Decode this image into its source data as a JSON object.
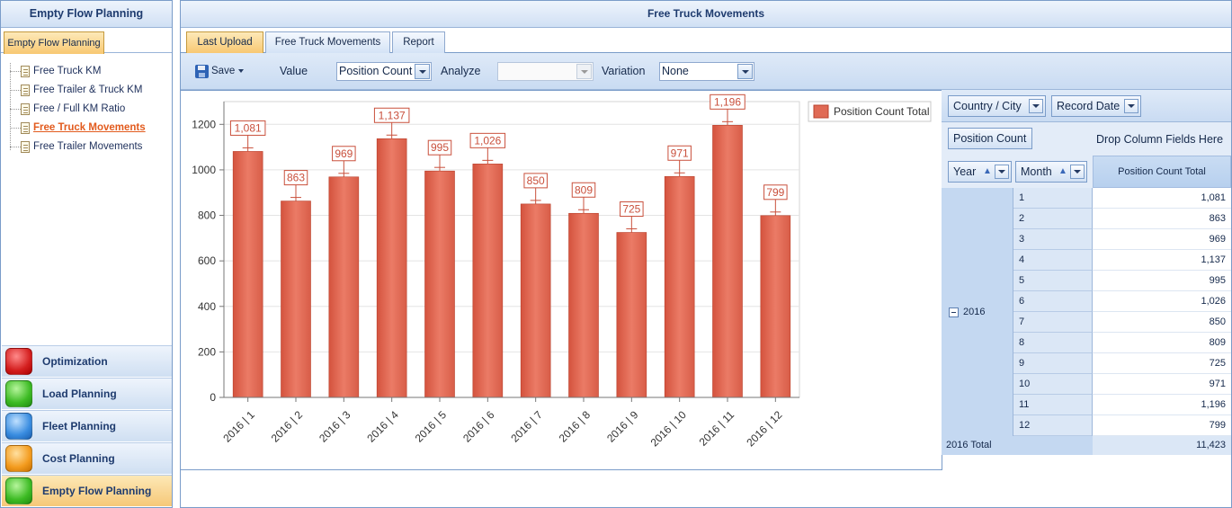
{
  "left_panel": {
    "title": "Empty Flow Planning",
    "tab_label": "Empty Flow Planning",
    "tree_items": [
      {
        "label": "Free Truck KM"
      },
      {
        "label": "Free Trailer & Truck KM"
      },
      {
        "label": "Free / Full KM Ratio"
      },
      {
        "label": "Free Truck Movements"
      },
      {
        "label": "Free Trailer Movements"
      }
    ],
    "active_tree_item": "Free Truck Movements",
    "nav_buttons": [
      {
        "label": "Optimization",
        "icon": "red-square-icon"
      },
      {
        "label": "Load Planning",
        "icon": "green-square-icon"
      },
      {
        "label": "Fleet Planning",
        "icon": "blue-square-icon"
      },
      {
        "label": "Cost Planning",
        "icon": "orange-square-icon"
      },
      {
        "label": "Empty Flow Planning",
        "icon": "green-square-icon"
      }
    ],
    "active_nav": "Empty Flow Planning"
  },
  "main": {
    "title": "Free Truck Movements",
    "tabs": [
      {
        "label": "Last Upload"
      },
      {
        "label": "Free Truck Movements"
      },
      {
        "label": "Report"
      }
    ],
    "active_tab": "Last Upload",
    "toolbar": {
      "save_label": "Save",
      "value_label": "Value",
      "value_selected": "Position Count",
      "analyze_label": "Analyze",
      "analyze_selected": "",
      "variation_label": "Variation",
      "variation_selected": "None"
    }
  },
  "chart_data": {
    "type": "bar",
    "categories": [
      "2016 | 1",
      "2016 | 2",
      "2016 | 3",
      "2016 | 4",
      "2016 | 5",
      "2016 | 6",
      "2016 | 7",
      "2016 | 8",
      "2016 | 9",
      "2016 | 10",
      "2016 | 11",
      "2016 | 12"
    ],
    "series": [
      {
        "name": "Position Count Total",
        "values": [
          1081,
          863,
          969,
          1137,
          995,
          1026,
          850,
          809,
          725,
          971,
          1196,
          799
        ]
      }
    ],
    "data_labels": [
      "1,081",
      "863",
      "969",
      "1,137",
      "995",
      "1,026",
      "850",
      "809",
      "725",
      "971",
      "1,196",
      "799"
    ],
    "yticks": [
      0,
      200,
      400,
      600,
      800,
      1000,
      1200
    ],
    "ylim": [
      0,
      1300
    ],
    "grid": true,
    "legend_position": "top-right",
    "bar_color": "#e06a55"
  },
  "pivot": {
    "filter_fields": [
      {
        "label": "Country / City"
      },
      {
        "label": "Record Date"
      }
    ],
    "data_field": "Position Count",
    "drop_hint": "Drop Column Fields Here",
    "row_fields": [
      {
        "label": "Year"
      },
      {
        "label": "Month"
      }
    ],
    "column_header": "Position Count Total",
    "year": "2016",
    "rows": [
      {
        "month": "1",
        "value": "1,081"
      },
      {
        "month": "2",
        "value": "863"
      },
      {
        "month": "3",
        "value": "969"
      },
      {
        "month": "4",
        "value": "1,137"
      },
      {
        "month": "5",
        "value": "995"
      },
      {
        "month": "6",
        "value": "1,026"
      },
      {
        "month": "7",
        "value": "850"
      },
      {
        "month": "8",
        "value": "809"
      },
      {
        "month": "9",
        "value": "725"
      },
      {
        "month": "10",
        "value": "971"
      },
      {
        "month": "11",
        "value": "1,196"
      },
      {
        "month": "12",
        "value": "799"
      }
    ],
    "total_label": "2016 Total",
    "total_value": "11,423"
  }
}
